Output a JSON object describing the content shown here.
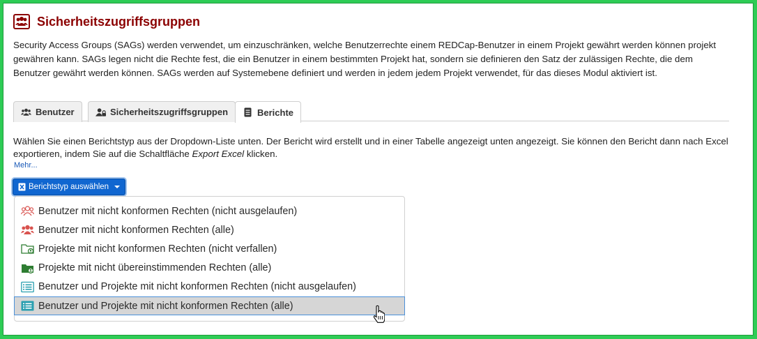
{
  "header": {
    "title": "Sicherheitszugriffsgruppen",
    "icon": "users-shield-icon",
    "color": "#8b0000"
  },
  "description": "Security Access Groups (SAGs) werden verwendet, um einzuschränken, welche Benutzerrechte einem REDCap-Benutzer in einem Projekt gewährt werden können projekt gewähren kann. SAGs legen nicht die Rechte fest, die ein Benutzer in einem bestimmten Projekt hat, sondern sie definieren den Satz der zulässigen Rechte, die dem Benutzer gewährt werden können. SAGs werden auf Systemebene definiert und werden in jedem jedem Projekt verwendet, für das dieses Modul aktiviert ist.",
  "tabs": [
    {
      "label": "Benutzer",
      "icon": "users-icon",
      "active": false
    },
    {
      "label": "Sicherheitszugriffsgruppen",
      "icon": "user-lock-icon",
      "active": false
    },
    {
      "label": "Berichte",
      "icon": "document-icon",
      "active": true
    }
  ],
  "intro": {
    "part1": "Wählen Sie einen Berichtstyp aus der Dropdown-Liste unten. Der Bericht wird erstellt und in einer Tabelle angezeigt unten angezeigt. Sie können den Bericht dann nach Excel exportieren, indem Sie auf die Schaltfläche ",
    "emphasis": "Export Excel",
    "part2": " klicken."
  },
  "more_link": "Mehr...",
  "dropdown": {
    "label": "Berichtstyp auswählen",
    "icon": "excel-file-icon",
    "color": "#1066d0"
  },
  "menu_items": [
    {
      "label": "Benutzer mit nicht konformen Rechten (nicht ausgelaufen)",
      "icon": "users-outline-icon",
      "color": "#d9534f"
    },
    {
      "label": "Benutzer mit nicht konformen Rechten (alle)",
      "icon": "users-icon",
      "color": "#d9534f"
    },
    {
      "label": "Projekte mit nicht konformen Rechten (nicht verfallen)",
      "icon": "folder-user-outline-icon",
      "color": "#2e7d32"
    },
    {
      "label": "Projekte mit nicht übereinstimmenden Rechten (alle)",
      "icon": "folder-user-icon",
      "color": "#2e7d32"
    },
    {
      "label": "Benutzer und Projekte mit nicht konformen Rechten (nicht ausgelaufen)",
      "icon": "list-outline-icon",
      "color": "#2a9fb0"
    },
    {
      "label": "Benutzer und Projekte mit nicht konformen Rechten (alle)",
      "icon": "list-icon",
      "color": "#2a9fb0",
      "hovered": true
    }
  ]
}
